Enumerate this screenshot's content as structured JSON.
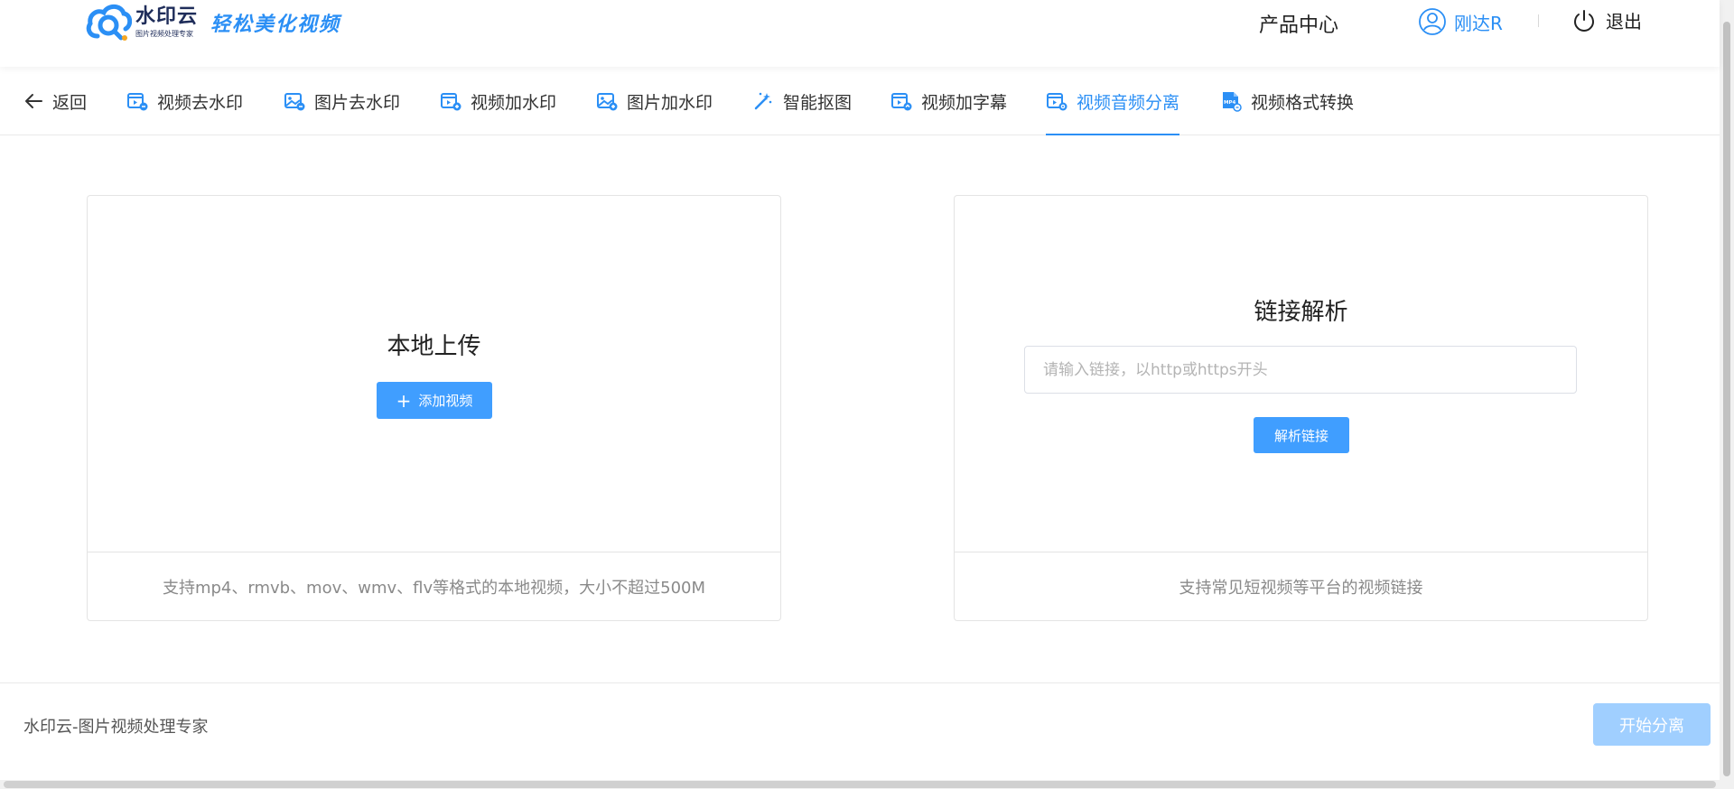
{
  "header": {
    "logo_name": "水印云",
    "logo_sub": "图片视频处理专家",
    "slogan": "轻松美化视频",
    "product_center": "产品中心",
    "user_name": "刚达R",
    "logout": "退出",
    "accent_color": "#2b8ff5"
  },
  "tabs": {
    "back": "返回",
    "items": [
      {
        "label": "视频去水印",
        "icon": "video-remove-watermark-icon"
      },
      {
        "label": "图片去水印",
        "icon": "image-remove-watermark-icon"
      },
      {
        "label": "视频加水印",
        "icon": "video-add-watermark-icon"
      },
      {
        "label": "图片加水印",
        "icon": "image-add-watermark-icon"
      },
      {
        "label": "智能抠图",
        "icon": "magic-wand-icon"
      },
      {
        "label": "视频加字幕",
        "icon": "video-subtitle-icon"
      },
      {
        "label": "视频音频分离",
        "icon": "video-audio-split-icon",
        "active": true
      },
      {
        "label": "视频格式转换",
        "icon": "mp4-format-icon"
      }
    ]
  },
  "upload_card": {
    "title": "本地上传",
    "button": "添加视频",
    "footer": "支持mp4、rmvb、mov、wmv、flv等格式的本地视频，大小不超过500M"
  },
  "link_card": {
    "title": "链接解析",
    "input_placeholder": "请输入链接，以http或https开头",
    "input_value": "",
    "button": "解析链接",
    "footer": "支持常见短视频等平台的视频链接"
  },
  "bottom": {
    "text": "水印云-图片视频处理专家",
    "start_button": "开始分离"
  }
}
